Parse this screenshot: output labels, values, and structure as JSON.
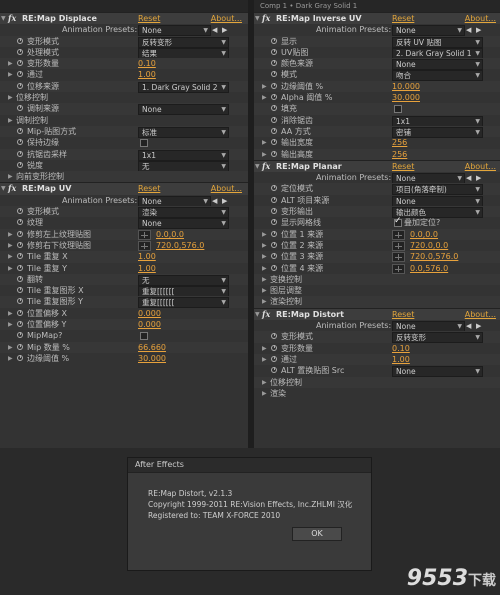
{
  "left_panel": {
    "effects": [
      {
        "name": "RE:Map Displace",
        "reset": "Reset",
        "about": "About...",
        "rows": [
          {
            "label": "Animation Presets:",
            "type": "preset",
            "value": "None"
          },
          {
            "label": "变形模式",
            "type": "dropdown",
            "value": "反转变形"
          },
          {
            "label": "处理模式",
            "type": "dropdown",
            "value": "结果"
          },
          {
            "label": "变形数量",
            "type": "number",
            "value": "0.10"
          },
          {
            "label": "通过",
            "type": "number",
            "value": "1.00"
          },
          {
            "label": "位移来源",
            "type": "dropdown",
            "value": "1. Dark Gray Solid 2"
          },
          {
            "label": "位移控制",
            "type": "group",
            "value": ""
          },
          {
            "label": "调制来源",
            "type": "dropdown",
            "value": "None"
          },
          {
            "label": "调制控制",
            "type": "group",
            "value": ""
          },
          {
            "label": "Mip-贴图方式",
            "type": "dropdown",
            "value": "标准"
          },
          {
            "label": "保持边缘",
            "type": "checkbox",
            "value": ""
          },
          {
            "label": "抗锯齿采样",
            "type": "dropdown",
            "value": "1x1"
          },
          {
            "label": "锐度",
            "type": "dropdown",
            "value": "无"
          },
          {
            "label": "向前变形控制",
            "type": "group",
            "value": ""
          }
        ]
      },
      {
        "name": "RE:Map UV",
        "reset": "Reset",
        "about": "About...",
        "rows": [
          {
            "label": "Animation Presets:",
            "type": "preset",
            "value": "None"
          },
          {
            "label": "变形模式",
            "type": "dropdown",
            "value": "渲染"
          },
          {
            "label": "纹理",
            "type": "dropdown",
            "value": "None"
          },
          {
            "label": "修剪左上纹理贴图",
            "type": "point",
            "value": "0.0,0.0"
          },
          {
            "label": "修剪右下纹理贴图",
            "type": "point",
            "value": "720.0,576.0"
          },
          {
            "label": "Tile 重复 X",
            "type": "number",
            "value": "1.00"
          },
          {
            "label": "Tile 重复 Y",
            "type": "number",
            "value": "1.00"
          },
          {
            "label": "翻转",
            "type": "dropdown",
            "value": "无"
          },
          {
            "label": "Tile 重复图形 X",
            "type": "dropdown",
            "value": "重复[[[[[["
          },
          {
            "label": "Tile 重复图形 Y",
            "type": "dropdown",
            "value": "重复[[[[[["
          },
          {
            "label": "位置偏移 X",
            "type": "number",
            "value": "0.000"
          },
          {
            "label": "位置偏移 Y",
            "type": "number",
            "value": "0.000"
          },
          {
            "label": "MipMap?",
            "type": "checkbox",
            "value": ""
          },
          {
            "label": "Mip 数量 %",
            "type": "number",
            "value": "66.660"
          },
          {
            "label": "边缘阈值 %",
            "type": "number",
            "value": "30.000"
          }
        ]
      }
    ]
  },
  "right_panel": {
    "header": "Comp 1 • Dark Gray Solid 1",
    "effects": [
      {
        "name": "RE:Map Inverse UV",
        "reset": "Reset",
        "about": "About...",
        "rows": [
          {
            "label": "Animation Presets:",
            "type": "preset",
            "value": "None"
          },
          {
            "label": "显示",
            "type": "dropdown",
            "value": "反转 UV 贴图"
          },
          {
            "label": "UV贴图",
            "type": "dropdown",
            "value": "2. Dark Gray Solid 1"
          },
          {
            "label": "颜色来源",
            "type": "dropdown",
            "value": "None"
          },
          {
            "label": "模式",
            "type": "dropdown",
            "value": "吻合"
          },
          {
            "label": "边缘阈值 %",
            "type": "number",
            "value": "10.000"
          },
          {
            "label": "Alpha 阈值 %",
            "type": "number",
            "value": "30.000"
          },
          {
            "label": "填充",
            "type": "checkbox",
            "value": ""
          },
          {
            "label": "消除锯齿",
            "type": "dropdown",
            "value": "1x1"
          },
          {
            "label": "AA 方式",
            "type": "dropdown",
            "value": "密铺"
          },
          {
            "label": "输出宽度",
            "type": "number",
            "value": "256"
          },
          {
            "label": "输出高度",
            "type": "number",
            "value": "256"
          }
        ]
      },
      {
        "name": "RE:Map Planar",
        "reset": "Reset",
        "about": "About...",
        "rows": [
          {
            "label": "Animation Presets:",
            "type": "preset",
            "value": "None"
          },
          {
            "label": "定位模式",
            "type": "dropdown",
            "value": "项目(角落牵制)"
          },
          {
            "label": "ALT 项目来源",
            "type": "dropdown",
            "value": "None"
          },
          {
            "label": "变形输出",
            "type": "dropdown",
            "value": "输出颜色"
          },
          {
            "label": "显示网格线",
            "type": "checkbox",
            "value": "叠加定位?"
          },
          {
            "label": "位置 1 来源",
            "type": "point",
            "value": "0.0,0.0"
          },
          {
            "label": "位置 2 来源",
            "type": "point",
            "value": "720.0,0.0"
          },
          {
            "label": "位置 3 来源",
            "type": "point",
            "value": "720.0,576.0"
          },
          {
            "label": "位置 4 来源",
            "type": "point",
            "value": "0.0,576.0"
          },
          {
            "label": "变换控制",
            "type": "group",
            "value": ""
          },
          {
            "label": "图层调整",
            "type": "group",
            "value": ""
          },
          {
            "label": "渲染控制",
            "type": "group",
            "value": ""
          }
        ]
      },
      {
        "name": "RE:Map Distort",
        "reset": "Reset",
        "about": "About...",
        "rows": [
          {
            "label": "Animation Presets:",
            "type": "preset",
            "value": "None"
          },
          {
            "label": "变形模式",
            "type": "dropdown",
            "value": "反转变形"
          },
          {
            "label": "变形数量",
            "type": "number",
            "value": "0.10"
          },
          {
            "label": "通过",
            "type": "number",
            "value": "1.00"
          },
          {
            "label": "ALT 置换贴图 Src",
            "type": "dropdown",
            "value": "None"
          },
          {
            "label": "位移控制",
            "type": "group",
            "value": ""
          },
          {
            "label": "渲染",
            "type": "group",
            "value": ""
          }
        ]
      }
    ]
  },
  "dialog": {
    "title": "After Effects",
    "line1": "RE:Map Distort, v2.1.3",
    "line2": "Copyright 1999-2011 RE:Vision Effects, Inc.ZHLMI 汉化",
    "line3": "Registered to: TEAM X-FORCE 2010",
    "ok_label": "OK"
  },
  "watermark": {
    "text": "9553",
    "suffix": "下载"
  },
  "colors": {
    "accent_orange": "#e8a23c",
    "panel_bg": "#333333",
    "dialog_bg": "#3a3a3a"
  }
}
